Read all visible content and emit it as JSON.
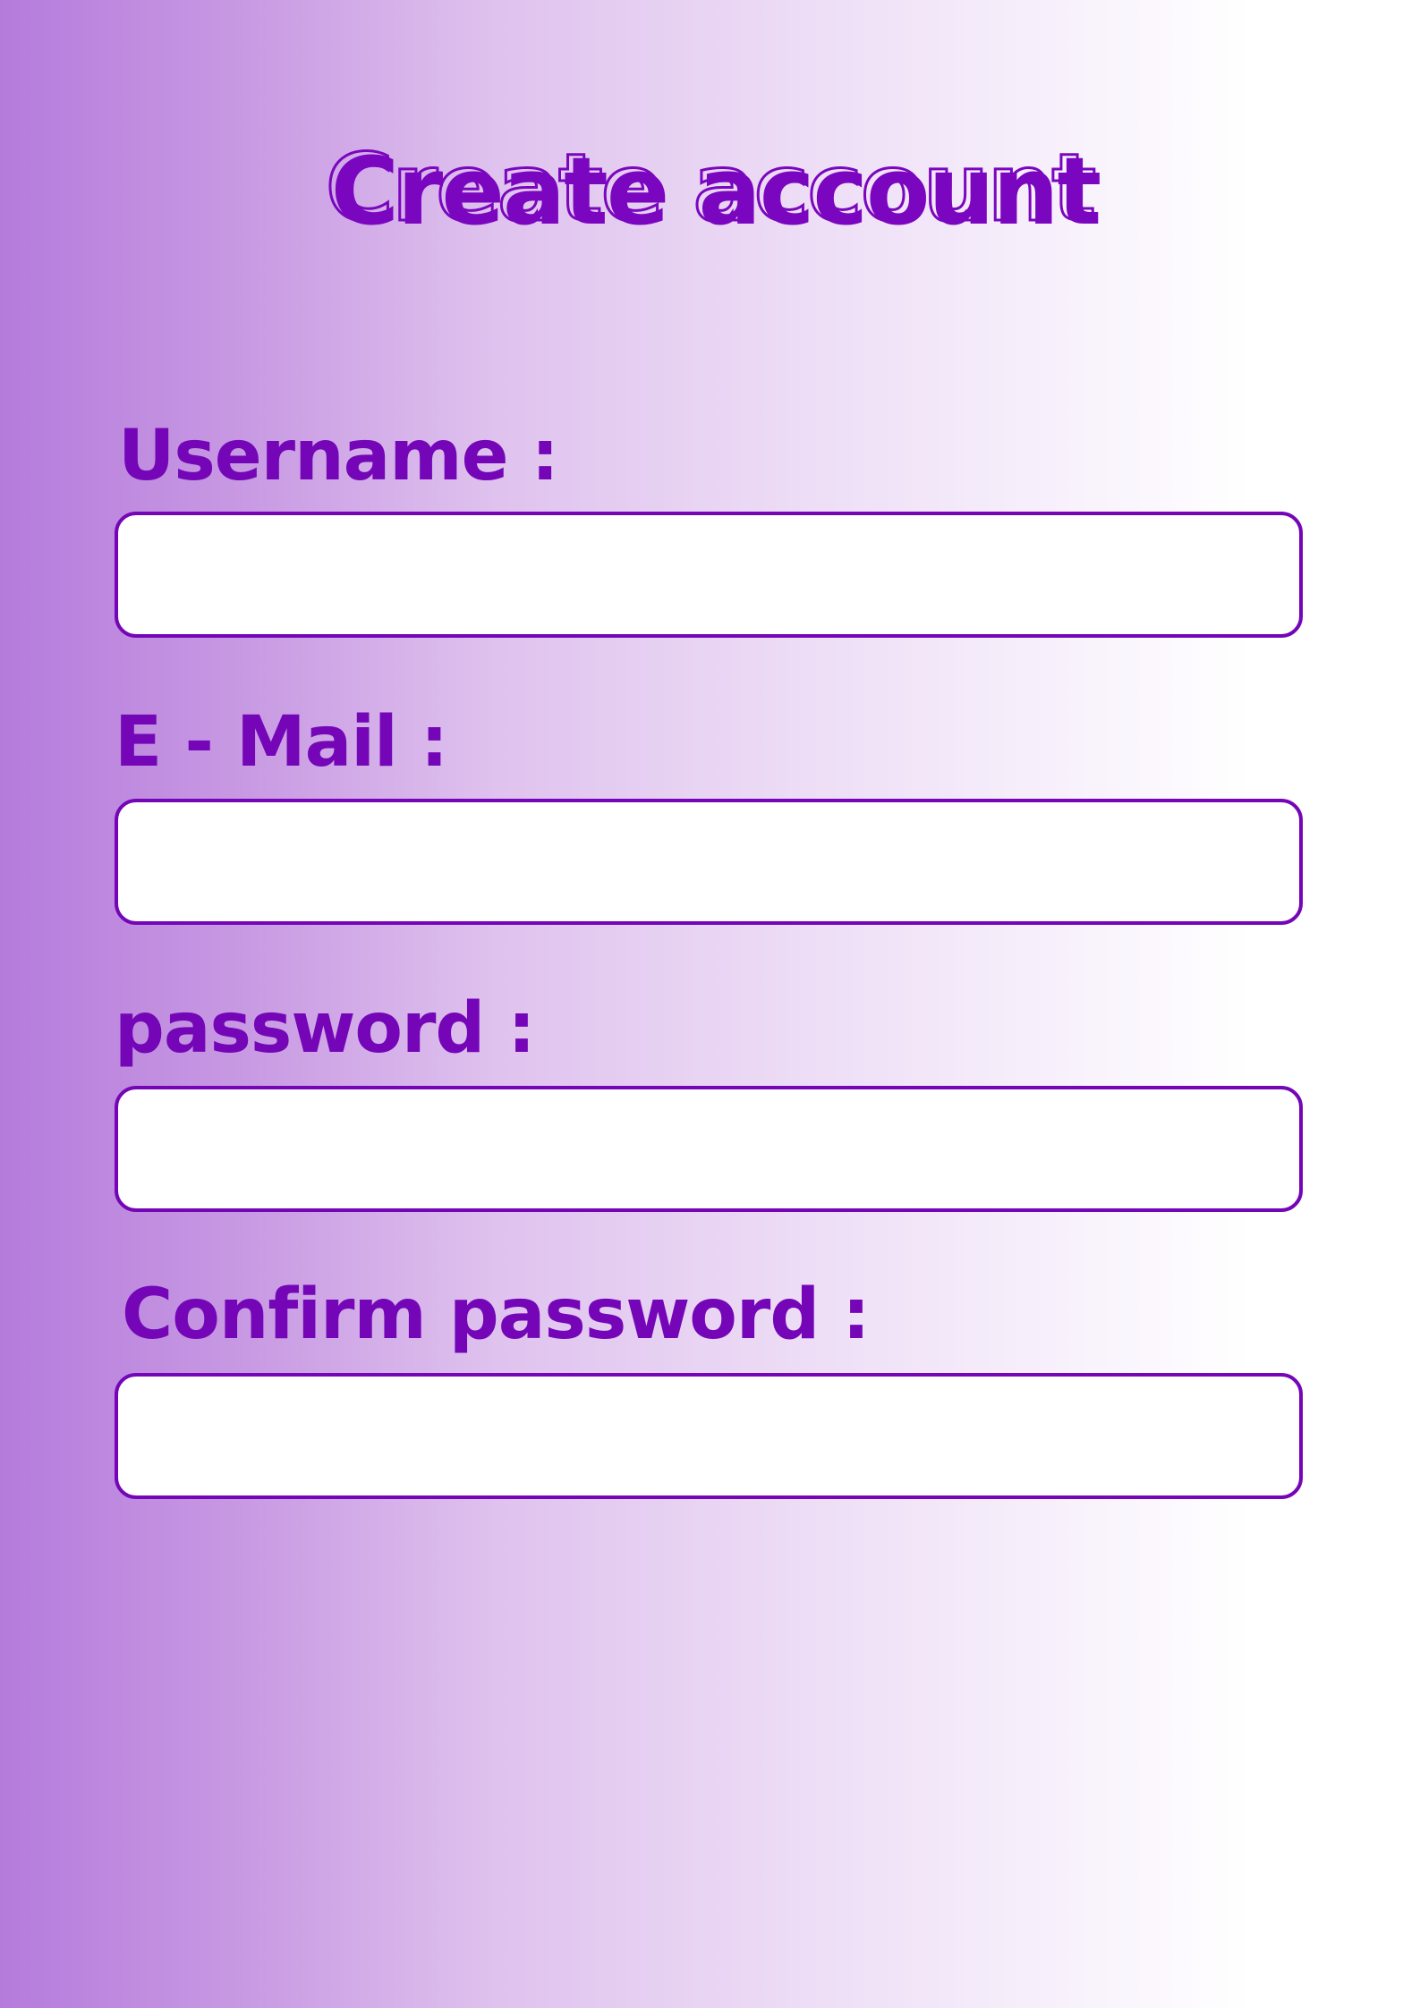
{
  "page": {
    "title": "Create account"
  },
  "form": {
    "username": {
      "label": "Username :",
      "value": ""
    },
    "email": {
      "label": "E - Mail  :",
      "value": ""
    },
    "password": {
      "label": "password :",
      "value": ""
    },
    "confirm_password": {
      "label": "Confirm password  :",
      "value": ""
    }
  },
  "colors": {
    "accent": "#7406b8",
    "gradient_start": "#b57bdc",
    "gradient_end": "#ffffff"
  }
}
